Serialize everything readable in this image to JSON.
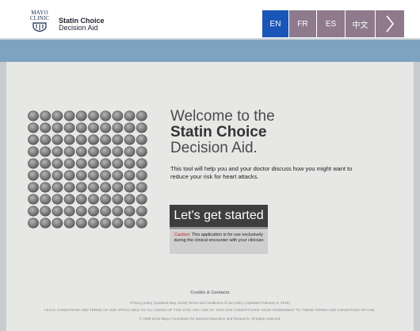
{
  "header": {
    "logo_text_1": "MAYO",
    "logo_text_2": "CLINIC",
    "app_title_1": "Statin Choice",
    "app_title_2": "Decision Aid",
    "languages": [
      {
        "label": "EN",
        "active": true
      },
      {
        "label": "FR",
        "active": false
      },
      {
        "label": "ES",
        "active": false
      },
      {
        "label": "中文",
        "active": false
      }
    ],
    "next_label": ">"
  },
  "colors": {
    "active_lang": "#1a56b8",
    "inactive_lang": "#8e7a8c",
    "band": "#7ea3c1",
    "button": "#3e3e3e",
    "caution_red": "#c41f1f"
  },
  "main": {
    "welcome_line1": "Welcome to the",
    "welcome_line2": "Statin Choice",
    "welcome_line3": "Decision Aid.",
    "description": "This tool will help you and your doctor discuss how you might want to reduce your risk for heart attacks.",
    "start_button": "Let's get started",
    "caution_label": "Caution:",
    "caution_text": "This application is for use exclusively during the clinical encounter with your clinician",
    "icon_grid": {
      "rows": 10,
      "columns": 10
    }
  },
  "footer": {
    "credits": "Credits & Contacts",
    "privacy": "Privacy policy (Updated May, 2015) Terms and conditions of use policy (Updated February 6, 2015)",
    "legal": "LEGAL CONDITIONS AND TERMS OF USE APPLICABLE TO ALL USERS OF THIS SITE. ANY USE OF THIS SITE CONSTITUTES YOUR AGREEMENT TO THESE TERMS AND CONDITIONS OF USE.",
    "copyright": "© 1998-2015 Mayo Foundation for Medical Education and Research. All rights reserved."
  }
}
